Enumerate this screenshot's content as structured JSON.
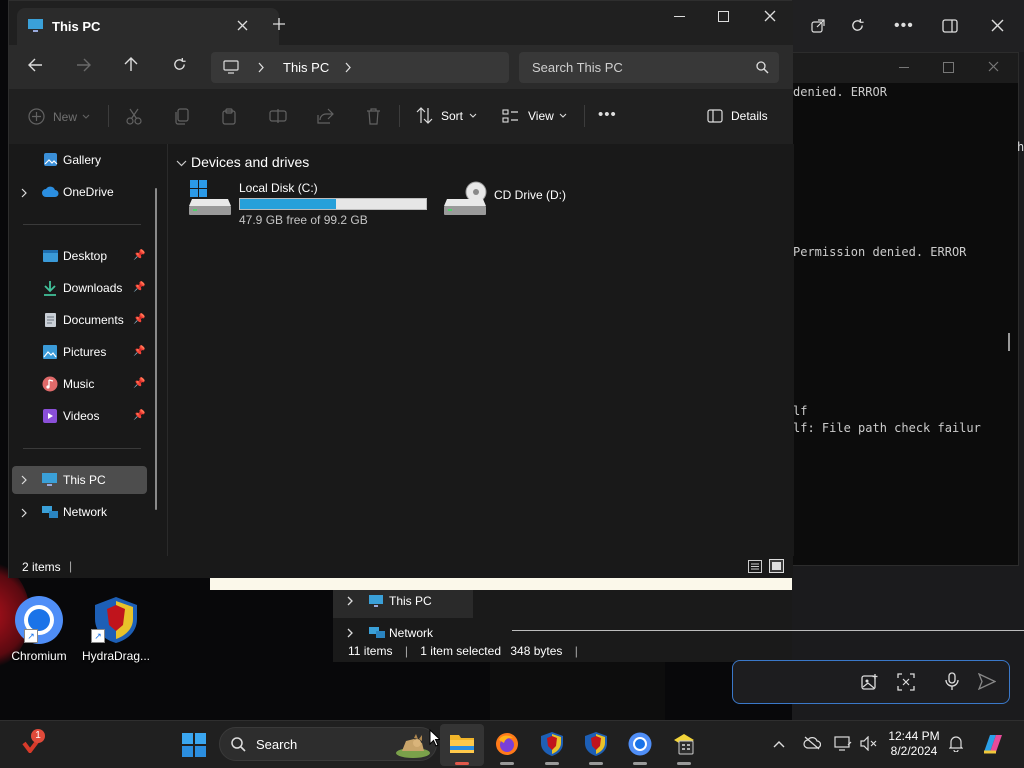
{
  "explorer": {
    "tab_title": "This PC",
    "breadcrumb": "This PC",
    "search_placeholder": "Search This PC",
    "toolbar": {
      "new_label": "New",
      "sort_label": "Sort",
      "view_label": "View",
      "details_label": "Details"
    },
    "nav": {
      "gallery": "Gallery",
      "onedrive": "OneDrive",
      "desktop": "Desktop",
      "downloads": "Downloads",
      "documents": "Documents",
      "pictures": "Pictures",
      "music": "Music",
      "videos": "Videos",
      "this_pc": "This PC",
      "network": "Network"
    },
    "group_header": "Devices and drives",
    "drives": [
      {
        "name": "Local Disk (C:)",
        "free_text": "47.9 GB free of 99.2 GB",
        "used_fraction": 0.517
      },
      {
        "name": "CD Drive (D:)"
      }
    ],
    "status_items": "2 items"
  },
  "background_explorer": {
    "this_pc": "This PC",
    "network": "Network",
    "status_items": "11 items",
    "status_selected": "1 item selected",
    "status_size": "348 bytes"
  },
  "terminal": {
    "lines": [
      "denied. ERROR",
      "Permission denied. ERROR",
      "lf",
      "lf: File path check failur"
    ],
    "side_char": "h"
  },
  "desktop": {
    "icons": [
      {
        "label": "Chromium"
      },
      {
        "label": "HydraDrag..."
      }
    ]
  },
  "taskbar": {
    "search_label": "Search",
    "notification_badge": "1",
    "clock_time": "12:44 PM",
    "clock_date": "8/2/2024"
  },
  "colors": {
    "accent": "#26a0da",
    "selection": "#4d4d4d",
    "chat_border": "#3a78c9"
  }
}
